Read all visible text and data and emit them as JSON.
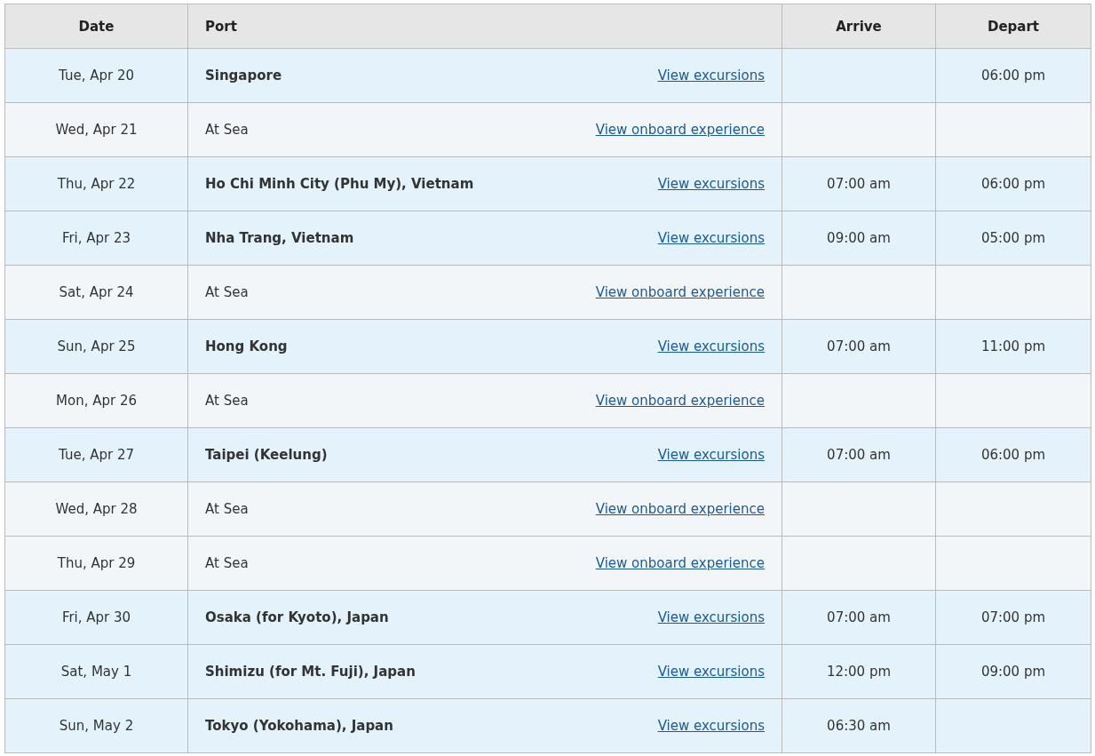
{
  "table": {
    "columns": [
      "Date",
      "Port",
      "Arrive",
      "Depart"
    ],
    "rows": [
      {
        "kind": "port",
        "date": "Tue, Apr 20",
        "port": "Singapore",
        "link": "View excursions",
        "arrive": "",
        "depart": "06:00 pm"
      },
      {
        "kind": "sea",
        "date": "Wed, Apr 21",
        "port": "At Sea",
        "link": "View onboard experience",
        "arrive": "",
        "depart": ""
      },
      {
        "kind": "port",
        "date": "Thu, Apr 22",
        "port": "Ho Chi Minh City (Phu My), Vietnam",
        "link": "View excursions",
        "arrive": "07:00 am",
        "depart": "06:00 pm"
      },
      {
        "kind": "port",
        "date": "Fri, Apr 23",
        "port": "Nha Trang, Vietnam",
        "link": "View excursions",
        "arrive": "09:00 am",
        "depart": "05:00 pm"
      },
      {
        "kind": "sea",
        "date": "Sat, Apr 24",
        "port": "At Sea",
        "link": "View onboard experience",
        "arrive": "",
        "depart": ""
      },
      {
        "kind": "port",
        "date": "Sun, Apr 25",
        "port": "Hong Kong",
        "link": "View excursions",
        "arrive": "07:00 am",
        "depart": "11:00 pm"
      },
      {
        "kind": "sea",
        "date": "Mon, Apr 26",
        "port": "At Sea",
        "link": "View onboard experience",
        "arrive": "",
        "depart": ""
      },
      {
        "kind": "port",
        "date": "Tue, Apr 27",
        "port": "Taipei (Keelung)",
        "link": "View excursions",
        "arrive": "07:00 am",
        "depart": "06:00 pm"
      },
      {
        "kind": "sea",
        "date": "Wed, Apr 28",
        "port": "At Sea",
        "link": "View onboard experience",
        "arrive": "",
        "depart": ""
      },
      {
        "kind": "sea",
        "date": "Thu, Apr 29",
        "port": "At Sea",
        "link": "View onboard experience",
        "arrive": "",
        "depart": ""
      },
      {
        "kind": "port",
        "date": "Fri, Apr 30",
        "port": "Osaka (for Kyoto), Japan",
        "link": "View excursions",
        "arrive": "07:00 am",
        "depart": "07:00 pm"
      },
      {
        "kind": "port",
        "date": "Sat, May 1",
        "port": "Shimizu (for Mt. Fuji), Japan",
        "link": "View excursions",
        "arrive": "12:00 pm",
        "depart": "09:00 pm"
      },
      {
        "kind": "port",
        "date": "Sun, May 2",
        "port": "Tokyo (Yokohama), Japan",
        "link": "View excursions",
        "arrive": "06:30 am",
        "depart": ""
      }
    ]
  }
}
